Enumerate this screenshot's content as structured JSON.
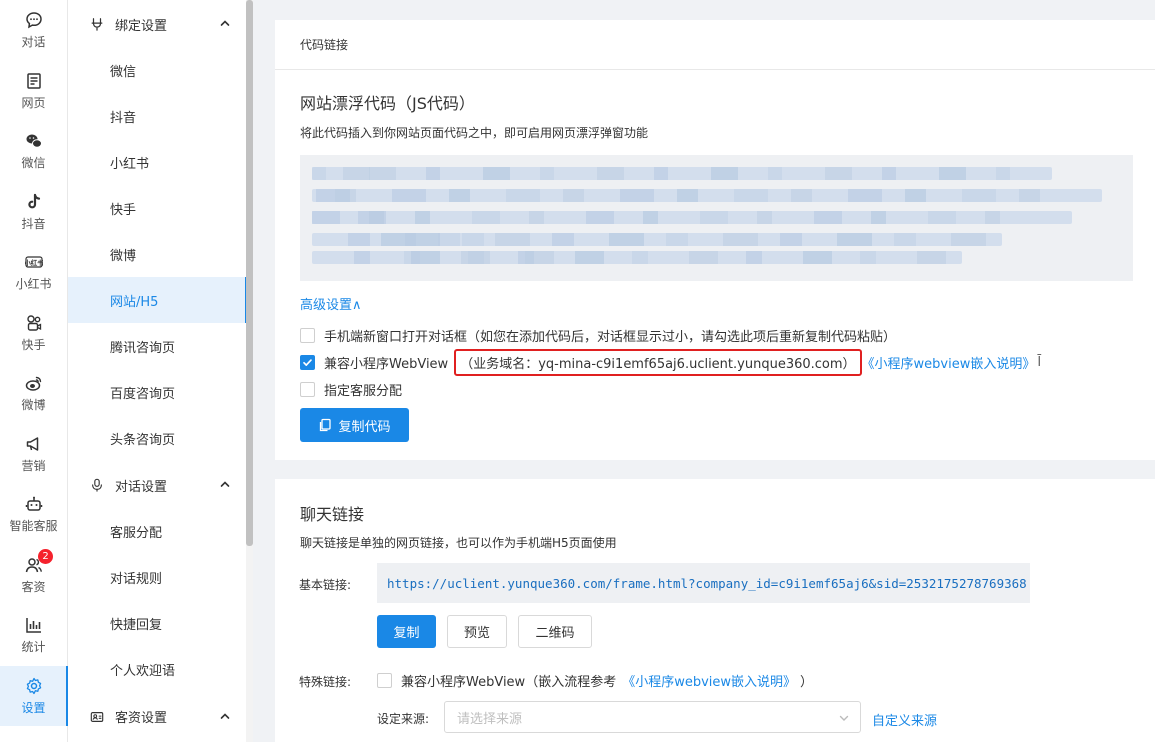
{
  "rail": [
    {
      "label": "对话",
      "icon": "chat-bubble-icon",
      "name": "chat"
    },
    {
      "label": "网页",
      "icon": "web-page-icon",
      "name": "web"
    },
    {
      "label": "微信",
      "icon": "wechat-icon",
      "name": "wechat"
    },
    {
      "label": "抖音",
      "icon": "douyin-icon",
      "name": "douyin"
    },
    {
      "label": "小红书",
      "icon": "xiaohongshu-icon",
      "name": "xiaohongshu"
    },
    {
      "label": "快手",
      "icon": "kuaishou-icon",
      "name": "kuaishou"
    },
    {
      "label": "微博",
      "icon": "weibo-icon",
      "name": "weibo"
    },
    {
      "label": "营销",
      "icon": "megaphone-icon",
      "name": "marketing"
    },
    {
      "label": "智能客服",
      "icon": "robot-icon",
      "name": "ai-service"
    },
    {
      "label": "客资",
      "icon": "contacts-icon",
      "name": "customers",
      "badge": "2"
    },
    {
      "label": "统计",
      "icon": "bar-chart-icon",
      "name": "stats"
    },
    {
      "label": "设置",
      "icon": "gear-icon",
      "name": "settings",
      "active": true
    }
  ],
  "submenu": {
    "bind_group": {
      "label": "绑定设置",
      "icon": "plug-icon"
    },
    "bind_items": [
      "微信",
      "抖音",
      "小红书",
      "快手",
      "微博",
      "网站/H5",
      "腾讯咨询页",
      "百度咨询页",
      "头条咨询页"
    ],
    "chat_group": {
      "label": "对话设置",
      "icon": "microphone-icon"
    },
    "chat_items": [
      "客服分配",
      "对话规则",
      "快捷回复",
      "个人欢迎语"
    ],
    "customer_group": {
      "label": "客资设置",
      "icon": "id-card-icon"
    }
  },
  "code_card": {
    "tab": "代码链接",
    "title": "网站漂浮代码（JS代码）",
    "desc": "将此代码插入到你网站页面代码之中，即可启用网页漂浮弹窗功能",
    "advanced": "高级设置∧",
    "opt_mobile": "手机端新窗口打开对话框（如您在添加代码后，对话框显示过小，请勾选此项后重新复制代码粘贴）",
    "opt_webview": "兼容小程序WebView",
    "domain": "（业务域名：yq-mina-c9i1emf65aj6.uclient.yunque360.com）",
    "webview_link": "《小程序webview嵌入说明》",
    "opt_assign": "指定客服分配",
    "copy_btn": "复制代码"
  },
  "chat_card": {
    "title": "聊天链接",
    "desc": "聊天链接是单独的网页链接，也可以作为手机端H5页面使用",
    "basic_label": "基本链接:",
    "url": "https://uclient.yunque360.com/frame.html?company_id=c9i1emf65aj6&sid=2532175278769368",
    "btn_copy": "复制",
    "btn_preview": "预览",
    "btn_qr": "二维码",
    "special_label": "特殊链接:",
    "special_opt": "兼容小程序WebView（嵌入流程参考",
    "special_link": "《小程序webview嵌入说明》",
    "special_close": "）",
    "source_label": "设定来源:",
    "source_placeholder": "请选择来源",
    "custom_source": "自定义来源"
  },
  "colors": {
    "accent": "#1a88e6",
    "highlight_border": "#e02020",
    "badge": "#f5222d"
  }
}
